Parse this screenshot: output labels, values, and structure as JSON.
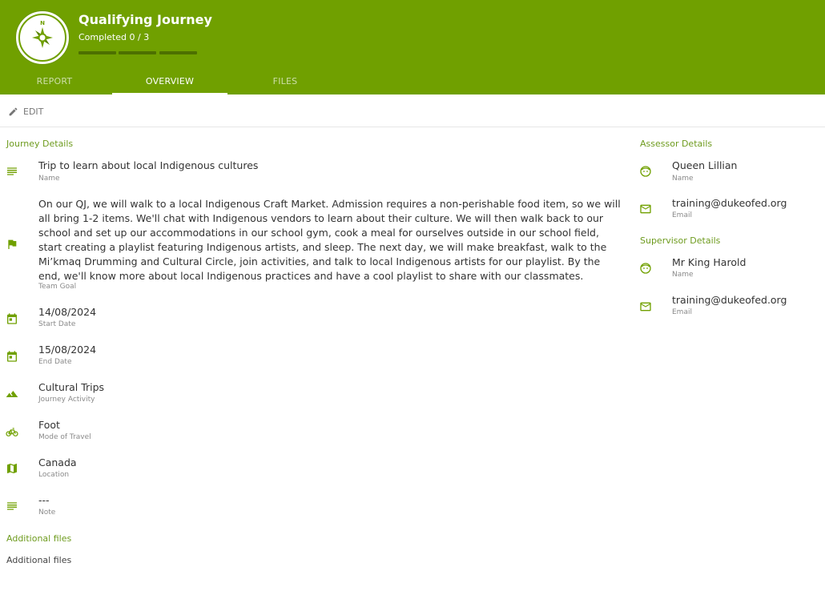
{
  "header": {
    "title": "Qualifying Journey",
    "progress_text": "Completed 0 / 3",
    "logo_letter": "N",
    "brand_color": "#70a000",
    "progress_segments": 3,
    "progress_completed": 0
  },
  "tabs": [
    {
      "label": "REPORT",
      "active": false
    },
    {
      "label": "OVERVIEW",
      "active": true
    },
    {
      "label": "FILES",
      "active": false
    }
  ],
  "toolbar": {
    "edit_label": "EDIT",
    "edit_icon": "pencil-icon"
  },
  "journey": {
    "section_title": "Journey Details",
    "name": {
      "value": "Trip to learn about local Indigenous cultures",
      "label": "Name",
      "icon": "notes-icon"
    },
    "goal": {
      "value": "On our QJ, we will walk to a local Indigenous Craft Market. Admission requires a non-perishable food item, so we will all bring 1-2 items. We'll chat with Indigenous vendors to learn about their culture. We will then walk back to our school and set up our accommodations in our school gym, cook a meal for ourselves outside in our school field, start creating a playlist featuring Indigenous artists, and sleep. The next day, we will make breakfast, walk to the Mi’kmaq Drumming and Cultural Circle, join activities, and talk to local Indigenous artists for our playlist. By the end, we'll know more about local Indigenous practices and have a cool playlist to share with our classmates.",
      "label": "Team Goal",
      "icon": "flag-icon"
    },
    "start_date": {
      "value": "14/08/2024",
      "label": "Start Date",
      "icon": "calendar-icon"
    },
    "end_date": {
      "value": "15/08/2024",
      "label": "End Date",
      "icon": "calendar-icon"
    },
    "activity": {
      "value": "Cultural Trips",
      "label": "Journey Activity",
      "icon": "mountain-icon"
    },
    "travel": {
      "value": "Foot",
      "label": "Mode of Travel",
      "icon": "bicycle-icon"
    },
    "location": {
      "value": "Canada",
      "label": "Location",
      "icon": "map-icon"
    },
    "note": {
      "value": "---",
      "label": "Note",
      "icon": "notes-icon"
    }
  },
  "additional_files": {
    "section_title": "Additional files",
    "text": "Additional files"
  },
  "assessor": {
    "section_title": "Assessor Details",
    "name": {
      "value": "Queen Lillian",
      "label": "Name",
      "icon": "face-icon"
    },
    "email": {
      "value": "training@dukeofed.org",
      "label": "Email",
      "icon": "mail-icon"
    }
  },
  "supervisor": {
    "section_title": "Supervisor Details",
    "name": {
      "value": "Mr King Harold",
      "label": "Name",
      "icon": "face-icon"
    },
    "email": {
      "value": "training@dukeofed.org",
      "label": "Email",
      "icon": "mail-icon"
    }
  }
}
